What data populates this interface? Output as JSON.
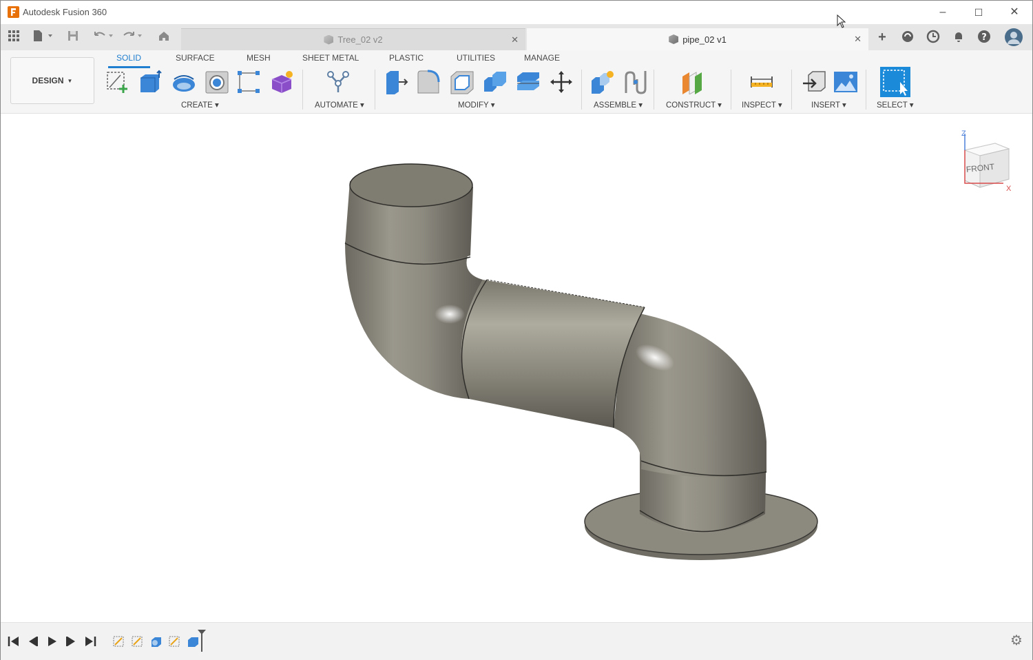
{
  "app": {
    "title": "Autodesk Fusion 360"
  },
  "tabs": [
    {
      "label": "Tree_02 v2",
      "active": false
    },
    {
      "label": "pipe_02 v1",
      "active": true
    }
  ],
  "workspace": {
    "label": "DESIGN"
  },
  "ribbon_tabs": [
    "SOLID",
    "SURFACE",
    "MESH",
    "SHEET METAL",
    "PLASTIC",
    "UTILITIES",
    "MANAGE"
  ],
  "groups": [
    "CREATE",
    "AUTOMATE",
    "MODIFY",
    "ASSEMBLE",
    "CONSTRUCT",
    "INSPECT",
    "INSERT",
    "SELECT"
  ],
  "viewcube": {
    "face": "FRONT",
    "axis_z": "Z",
    "axis_x": "X"
  },
  "colors": {
    "accent": "#1f7ecf",
    "brand": "#e8710a",
    "model": "#8a877d"
  }
}
